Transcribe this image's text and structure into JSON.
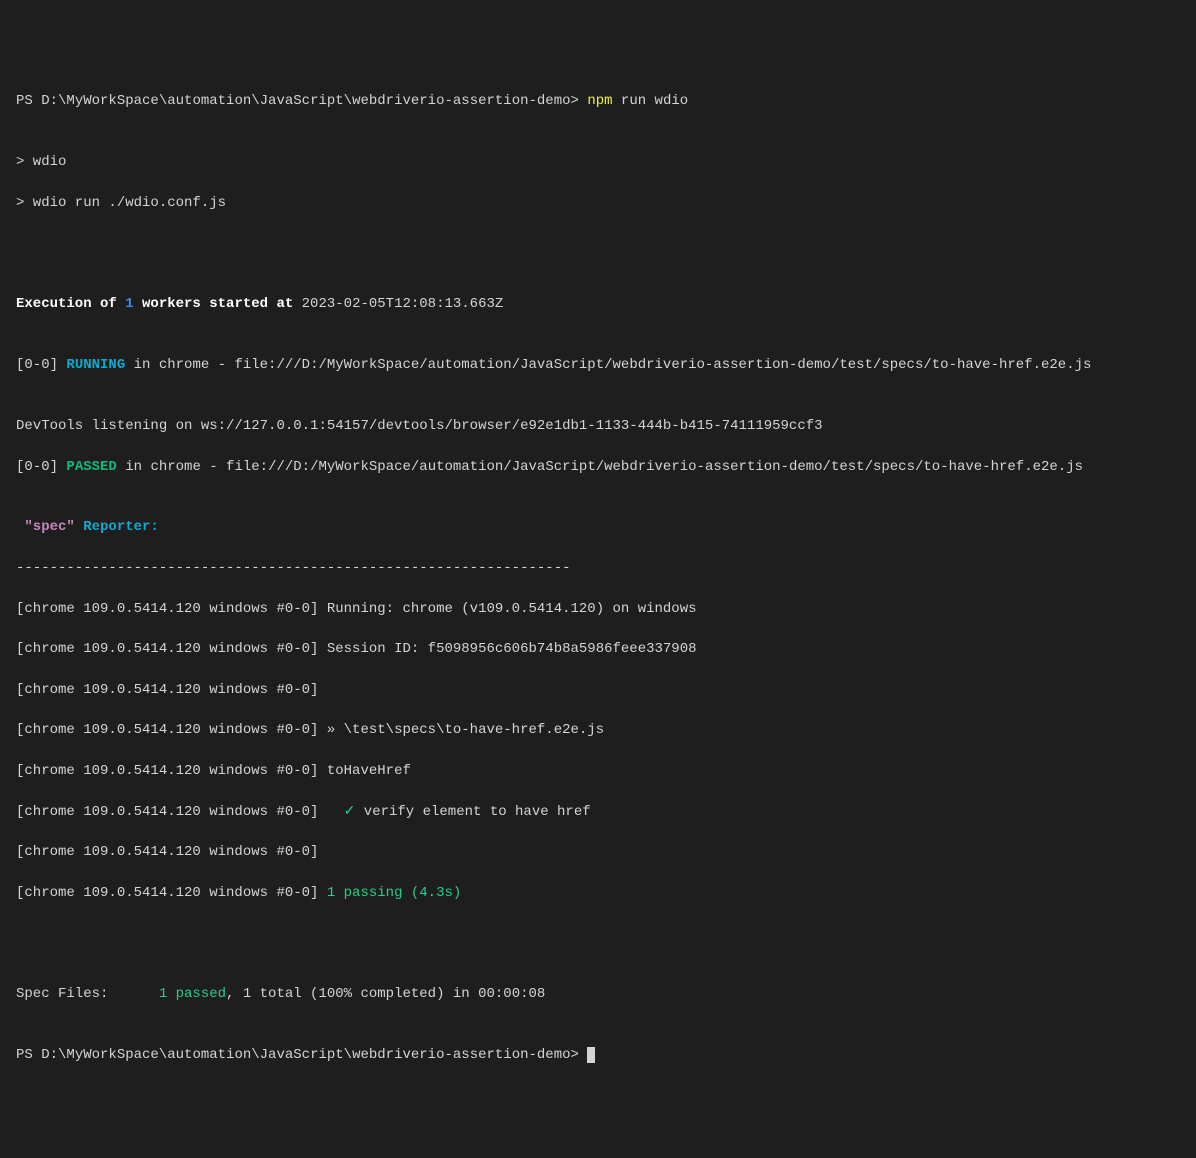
{
  "prompt1": {
    "ps": "PS ",
    "path": "D:\\MyWorkSpace\\automation\\JavaScript\\webdriverio-assertion-demo> ",
    "cmd_npm": "npm",
    "cmd_rest": " run wdio"
  },
  "script": {
    "line1": "> wdio",
    "line2": "> wdio run ./wdio.conf.js"
  },
  "exec": {
    "pre": "Execution of ",
    "count": "1",
    "post": " workers started at ",
    "time": "2023-02-05T12:08:13.663Z"
  },
  "running": {
    "prefix": "[0-0] ",
    "status": "RUNNING",
    "rest": " in chrome - file:///D:/MyWorkSpace/automation/JavaScript/webdriverio-assertion-demo/test/specs/to-have-href.e2e.js"
  },
  "devtools": "DevTools listening on ws://127.0.0.1:54157/devtools/browser/e92e1db1-1133-444b-b415-74111959ccf3",
  "passed": {
    "prefix": "[0-0] ",
    "status": "PASSED",
    "rest": " in chrome - file:///D:/MyWorkSpace/automation/JavaScript/webdriverio-assertion-demo/test/specs/to-have-href.e2e.js"
  },
  "reporter": {
    "spec": " \"spec\"",
    "label": " Reporter:"
  },
  "dashes": "------------------------------------------------------------------",
  "rows": {
    "prefix": "[chrome 109.0.5414.120 windows #0-0]",
    "r1": " Running: chrome (v109.0.5414.120) on windows",
    "r2": " Session ID: f5098956c606b74b8a5986feee337908",
    "r3": "",
    "r4": " » \\test\\specs\\to-have-href.e2e.js",
    "r5": " toHaveHref",
    "r6_check": "   ✓ ",
    "r6_text": "verify element to have href",
    "r7": "",
    "r8": " 1 passing (4.3s)"
  },
  "summary": {
    "label": "Spec Files:      ",
    "passed": "1 passed",
    "rest": ", 1 total (100% completed) in 00:00:08"
  },
  "prompt2": {
    "ps": "PS ",
    "path": "D:\\MyWorkSpace\\automation\\JavaScript\\webdriverio-assertion-demo> "
  }
}
